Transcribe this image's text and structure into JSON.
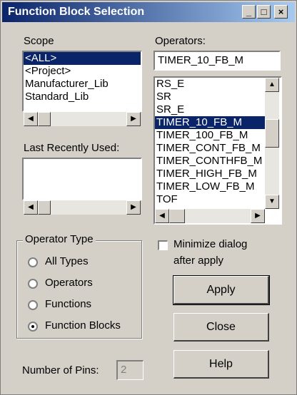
{
  "window": {
    "title": "Function Block Selection"
  },
  "title_buttons": {
    "minimize": "_",
    "maximize": "□",
    "close": "×"
  },
  "scope": {
    "label": "Scope",
    "items": [
      "<ALL>",
      "<Project>",
      "Manufacturer_Lib",
      "Standard_Lib"
    ],
    "selected_index": 0
  },
  "recent": {
    "label": "Last Recently Used:"
  },
  "operators": {
    "label": "Operators:",
    "input_value": "TIMER_10_FB_M",
    "items": [
      "RS_E",
      "SR",
      "SR_E",
      "TIMER_10_FB_M",
      "TIMER_100_FB_M",
      "TIMER_CONT_FB_M",
      "TIMER_CONTHFB_M",
      "TIMER_HIGH_FB_M",
      "TIMER_LOW_FB_M",
      "TOF"
    ],
    "selected_index": 3
  },
  "operator_type": {
    "label": "Operator Type",
    "options": [
      "All Types",
      "Operators",
      "Functions",
      "Function Blocks"
    ],
    "selected_index": 3
  },
  "minimize": {
    "label_line1": "Minimize dialog",
    "label_line2": "after apply",
    "checked": false
  },
  "buttons": {
    "apply": "Apply",
    "close": "Close",
    "help": "Help"
  },
  "pins": {
    "label": "Number of Pins:",
    "value": "2"
  },
  "scroll": {
    "left": "◀",
    "right": "▶",
    "up": "▲",
    "down": "▼"
  },
  "colors": {
    "title_start": "#0a246a",
    "title_end": "#a6caf0",
    "selection": "#0a246a",
    "face": "#d4d0c8"
  }
}
